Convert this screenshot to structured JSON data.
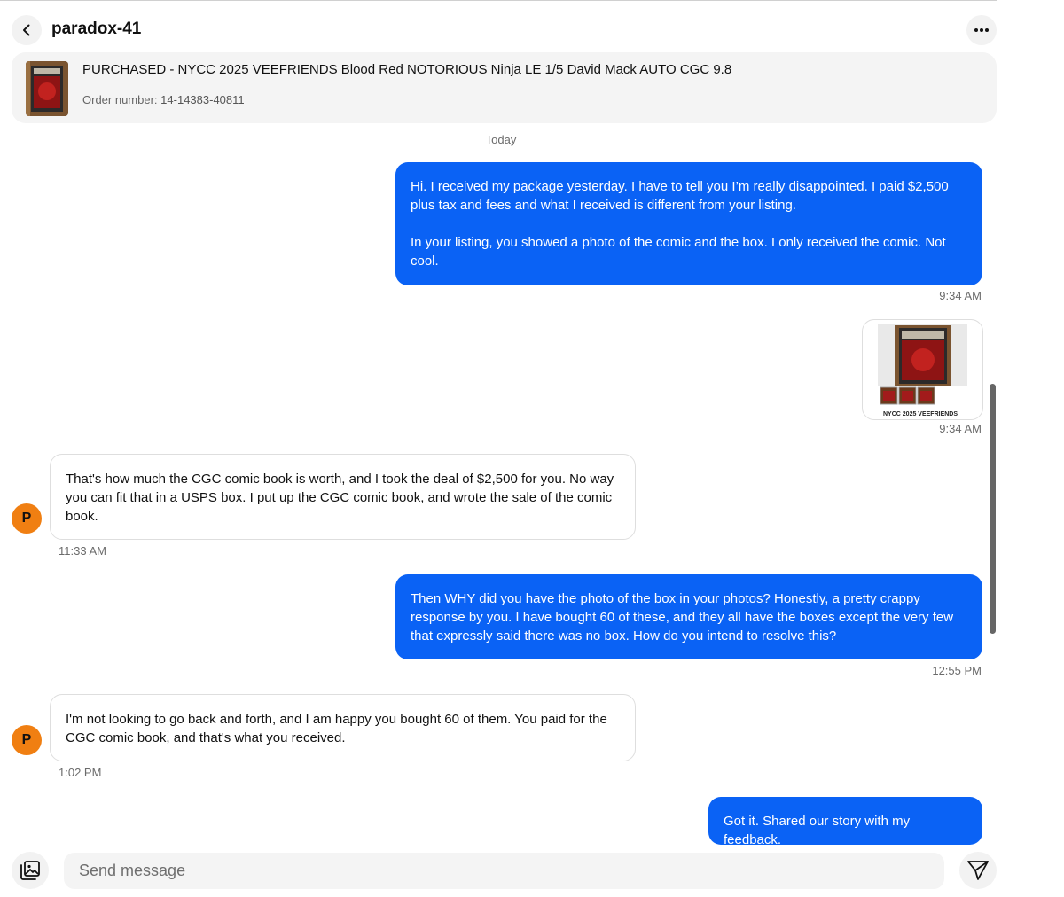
{
  "header": {
    "username": "paradox-41"
  },
  "order": {
    "title": "PURCHASED - NYCC 2025 VEEFRIENDS Blood Red NOTORIOUS Ninja LE 1/5 David Mack AUTO CGC 9.8",
    "number_label": "Order number:",
    "number": "14-14383-40811"
  },
  "conversation": {
    "date_divider": "Today",
    "messages": [
      {
        "sender": "me",
        "paragraphs": [
          "Hi. I received my package yesterday. I have to tell you I’m really disappointed. I paid $2,500 plus tax and fees and what I received is different from your listing.",
          "In your listing, you showed a photo of the comic and the box. I only received the comic. Not cool."
        ],
        "time": "9:34 AM"
      },
      {
        "sender": "me",
        "type": "image",
        "image_caption": "NYCC 2025 VEEFRIENDS",
        "time": "9:34 AM"
      },
      {
        "sender": "them",
        "avatar_initial": "P",
        "text": "That's how much the CGC comic book is worth, and I took the deal of $2,500 for you. No way you can fit that in a USPS box. I put up the CGC comic book, and wrote the sale of the comic book.",
        "time": "11:33 AM"
      },
      {
        "sender": "me",
        "text": "Then WHY did you have the photo of the box in your photos? Honestly, a pretty crappy response by you. I have bought 60 of these, and they all have the boxes except the very few that expressly said there was no box. How do you intend to resolve this?",
        "time": "12:55 PM"
      },
      {
        "sender": "them",
        "avatar_initial": "P",
        "text": "I'm not looking to go back and forth, and I am happy you bought 60 of them. You paid for the CGC comic book, and that's what you received.",
        "time": "1:02 PM"
      },
      {
        "sender": "me",
        "text": "Got it. Shared our story with my feedback."
      }
    ]
  },
  "composer": {
    "placeholder": "Send message"
  },
  "icons": {
    "back": "chevron-left-icon",
    "more": "more-horizontal-icon",
    "photo": "photo-gallery-icon",
    "send": "send-paper-plane-icon"
  },
  "colors": {
    "outgoing_bubble": "#0a62f5",
    "avatar": "#f07f12"
  }
}
